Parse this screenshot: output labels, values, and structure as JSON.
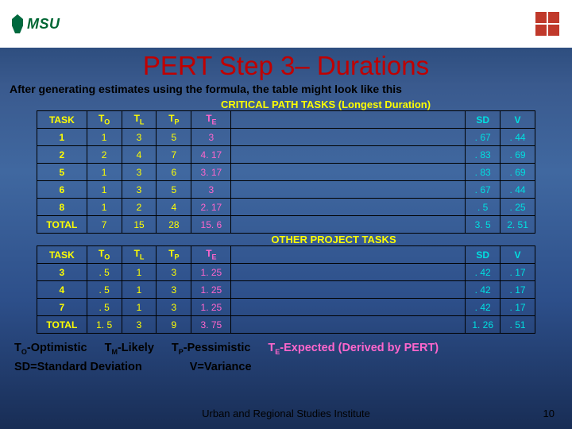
{
  "header": {
    "msu": "MSU"
  },
  "title": "PERT Step 3– Durations",
  "subtitle": "After generating estimates using the formula, the table might look like this",
  "banners": {
    "crit": "CRITICAL PATH TASKS  (Longest Duration)",
    "other": "OTHER PROJECT TASKS"
  },
  "cols": {
    "task": "TASK",
    "to": "T",
    "tl": "T",
    "tp": "T",
    "te": "T",
    "sd": "SD",
    "v": "V",
    "to_sub": "O",
    "tl_sub": "L",
    "tp_sub": "P",
    "te_sub": "E"
  },
  "crit": [
    {
      "task": "1",
      "to": "1",
      "tl": "3",
      "tp": "5",
      "te": "3",
      "sd": ". 67",
      "v": ". 44"
    },
    {
      "task": "2",
      "to": "2",
      "tl": "4",
      "tp": "7",
      "te": "4. 17",
      "sd": ". 83",
      "v": ". 69"
    },
    {
      "task": "5",
      "to": "1",
      "tl": "3",
      "tp": "6",
      "te": "3. 17",
      "sd": ". 83",
      "v": ". 69"
    },
    {
      "task": "6",
      "to": "1",
      "tl": "3",
      "tp": "5",
      "te": "3",
      "sd": ". 67",
      "v": ". 44"
    },
    {
      "task": "8",
      "to": "1",
      "tl": "2",
      "tp": "4",
      "te": "2. 17",
      "sd": ". 5",
      "v": ". 25"
    },
    {
      "task": "TOTAL",
      "to": "7",
      "tl": "15",
      "tp": "28",
      "te": "15. 6",
      "sd": "3. 5",
      "v": "2. 51"
    }
  ],
  "other": [
    {
      "task": "3",
      "to": ". 5",
      "tl": "1",
      "tp": "3",
      "te": "1. 25",
      "sd": ". 42",
      "v": ". 17"
    },
    {
      "task": "4",
      "to": ". 5",
      "tl": "1",
      "tp": "3",
      "te": "1. 25",
      "sd": ". 42",
      "v": ". 17"
    },
    {
      "task": "7",
      "to": ". 5",
      "tl": "1",
      "tp": "3",
      "te": "1. 25",
      "sd": ". 42",
      "v": ". 17"
    },
    {
      "task": "TOTAL",
      "to": "1. 5",
      "tl": "3",
      "tp": "9",
      "te": "3. 75",
      "sd": "1. 26",
      "v": ". 51"
    }
  ],
  "legend": {
    "to": "-Optimistic",
    "tm": "-Likely",
    "tp": "-Pessimistic",
    "te": "-Expected (Derived by PERT)",
    "sd": "SD=Standard Deviation",
    "v": "V=Variance",
    "T": "T",
    "o": "O",
    "m": "M",
    "p": "P",
    "e": "E"
  },
  "footer": {
    "inst": "Urban and Regional Studies Institute",
    "page": "10"
  },
  "chart_data": {
    "type": "table",
    "title": "PERT Step 3 – Durations",
    "sections": [
      {
        "name": "CRITICAL PATH TASKS (Longest Duration)",
        "columns": [
          "TASK",
          "TO",
          "TL",
          "TP",
          "TE",
          "SD",
          "V"
        ],
        "rows": [
          [
            "1",
            1,
            3,
            5,
            3,
            0.67,
            0.44
          ],
          [
            "2",
            2,
            4,
            7,
            4.17,
            0.83,
            0.69
          ],
          [
            "5",
            1,
            3,
            6,
            3.17,
            0.83,
            0.69
          ],
          [
            "6",
            1,
            3,
            5,
            3,
            0.67,
            0.44
          ],
          [
            "8",
            1,
            2,
            4,
            2.17,
            0.5,
            0.25
          ],
          [
            "TOTAL",
            7,
            15,
            28,
            15.6,
            3.5,
            2.51
          ]
        ]
      },
      {
        "name": "OTHER PROJECT TASKS",
        "columns": [
          "TASK",
          "TO",
          "TL",
          "TP",
          "TE",
          "SD",
          "V"
        ],
        "rows": [
          [
            "3",
            0.5,
            1,
            3,
            1.25,
            0.42,
            0.17
          ],
          [
            "4",
            0.5,
            1,
            3,
            1.25,
            0.42,
            0.17
          ],
          [
            "7",
            0.5,
            1,
            3,
            1.25,
            0.42,
            0.17
          ],
          [
            "TOTAL",
            1.5,
            3,
            9,
            3.75,
            1.26,
            0.51
          ]
        ]
      }
    ]
  }
}
